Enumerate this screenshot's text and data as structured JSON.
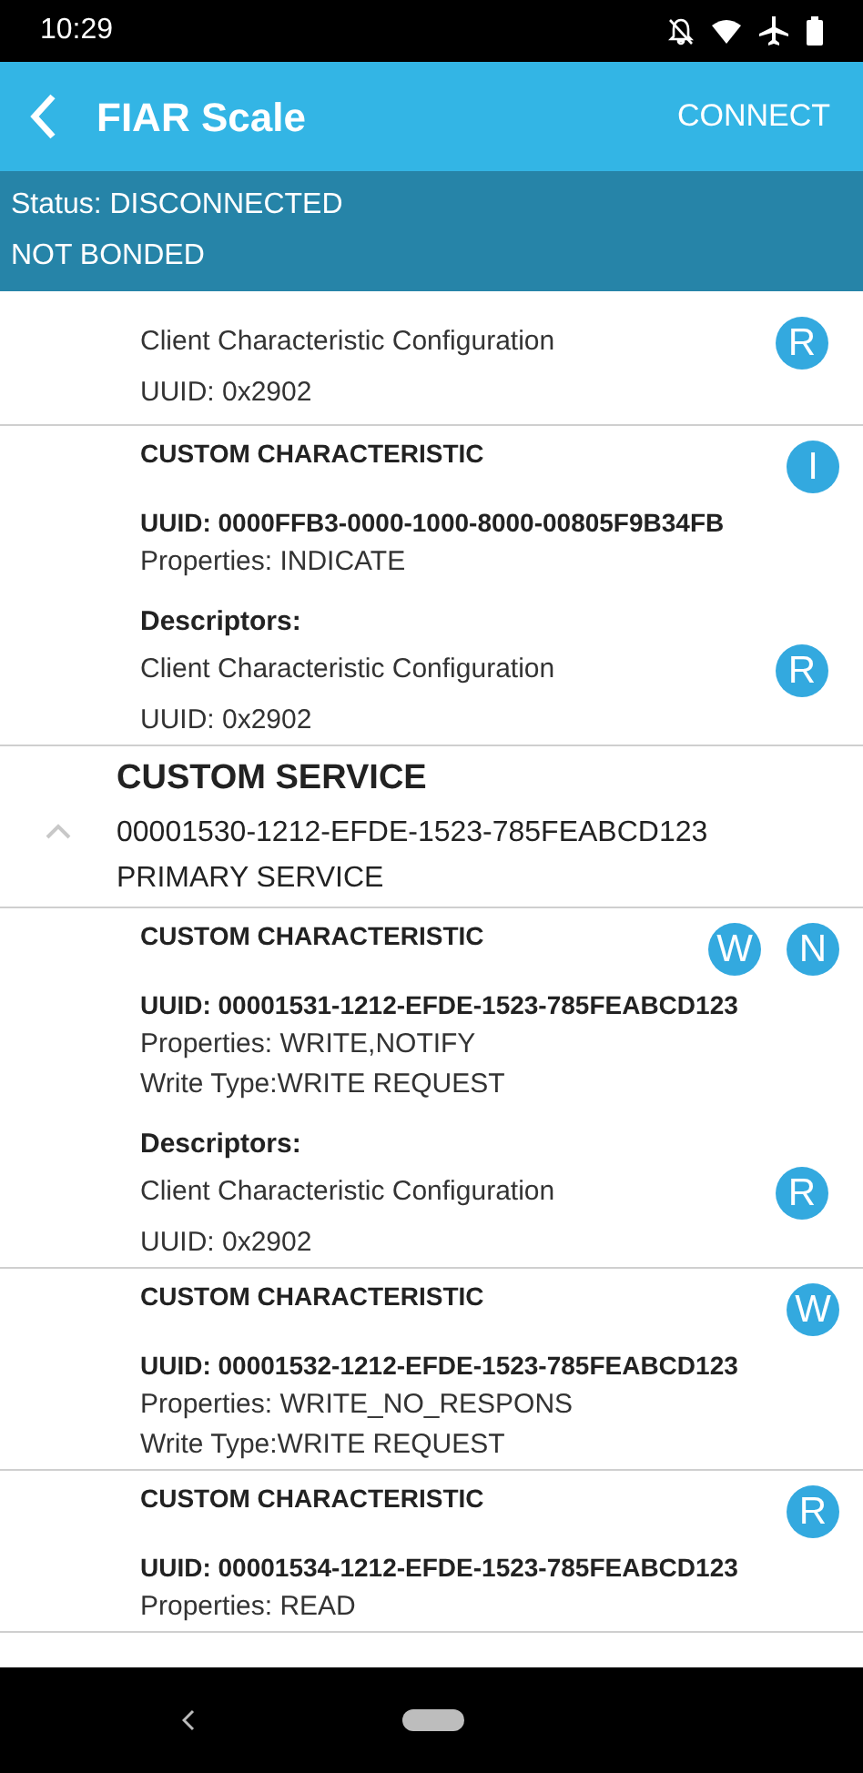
{
  "status_bar": {
    "time": "10:29"
  },
  "app_bar": {
    "title": "FIAR Scale",
    "action": "CONNECT"
  },
  "connection": {
    "status": "Status: DISCONNECTED",
    "bond": "NOT BONDED"
  },
  "items": [
    {
      "kind": "descriptors",
      "descriptors": [
        {
          "name": "Client Characteristic Configuration",
          "uuid": "UUID: 0x2902",
          "badge": "R"
        }
      ]
    },
    {
      "kind": "characteristic",
      "title": "CUSTOM CHARACTERISTIC",
      "badges": [
        "I"
      ],
      "uuid": "UUID: 0000FFB3-0000-1000-8000-00805F9B34FB",
      "properties": "Properties: INDICATE",
      "descriptors_label": "Descriptors:",
      "descriptors": [
        {
          "name": "Client Characteristic Configuration",
          "uuid": "UUID: 0x2902",
          "badge": "R"
        }
      ]
    },
    {
      "kind": "service",
      "title": "CUSTOM SERVICE",
      "uuid": "00001530-1212-EFDE-1523-785FEABCD123",
      "type": "PRIMARY SERVICE",
      "expanded": true
    },
    {
      "kind": "characteristic",
      "title": "CUSTOM CHARACTERISTIC",
      "badges": [
        "W",
        "N"
      ],
      "uuid": "UUID: 00001531-1212-EFDE-1523-785FEABCD123",
      "properties": "Properties: WRITE,NOTIFY",
      "write_type": "Write Type:WRITE REQUEST",
      "descriptors_label": "Descriptors:",
      "descriptors": [
        {
          "name": "Client Characteristic Configuration",
          "uuid": "UUID: 0x2902",
          "badge": "R"
        }
      ]
    },
    {
      "kind": "characteristic",
      "title": "CUSTOM CHARACTERISTIC",
      "badges": [
        "W"
      ],
      "uuid": "UUID: 00001532-1212-EFDE-1523-785FEABCD123",
      "properties": "Properties: WRITE_NO_RESPONS",
      "write_type": "Write Type:WRITE REQUEST"
    },
    {
      "kind": "characteristic",
      "title": "CUSTOM CHARACTERISTIC",
      "badges": [
        "R"
      ],
      "uuid": "UUID: 00001534-1212-EFDE-1523-785FEABCD123",
      "properties": "Properties: READ"
    }
  ]
}
